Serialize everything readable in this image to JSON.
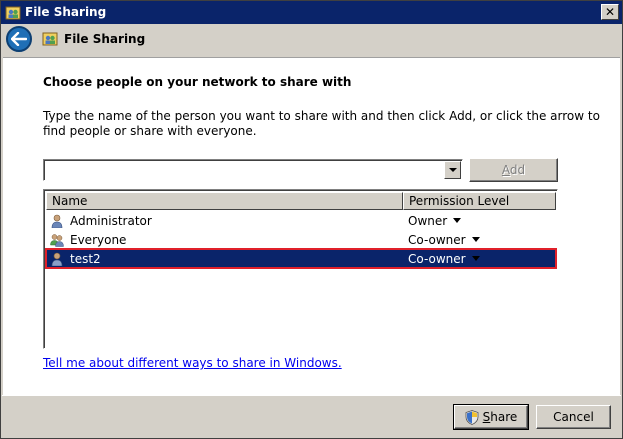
{
  "window": {
    "title": "File Sharing",
    "close_glyph": "✕"
  },
  "nav": {
    "title": "File Sharing"
  },
  "main": {
    "heading": "Choose people on your network to share with",
    "instructions": "Type the name of the person you want to share with and then click Add, or click the arrow to find people or share with everyone.",
    "input_value": "",
    "add_label": "Add",
    "columns": {
      "name": "Name",
      "permission": "Permission Level"
    },
    "rows": [
      {
        "name": "Administrator",
        "permission": "Owner",
        "icon": "user-icon"
      },
      {
        "name": "Everyone",
        "permission": "Co-owner",
        "icon": "group-icon"
      },
      {
        "name": "test2",
        "permission": "Co-owner",
        "icon": "user-icon",
        "selected": true
      }
    ],
    "help_link": "Tell me about different ways to share in Windows."
  },
  "footer": {
    "share_label": "Share",
    "cancel_label": "Cancel"
  },
  "colors": {
    "titlebar": "#0a246a",
    "selection": "#0a246a",
    "selection_outline": "#e0202a",
    "link": "#0000ee"
  }
}
